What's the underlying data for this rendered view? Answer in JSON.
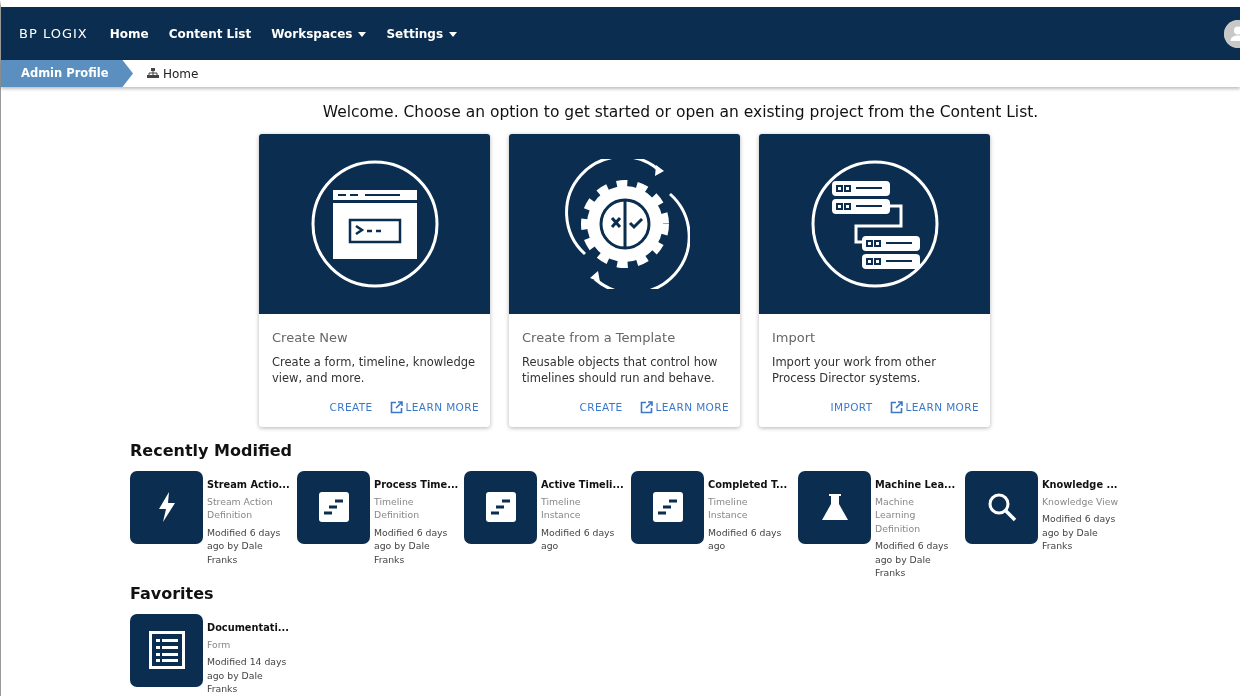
{
  "navbar": {
    "logo": "BP LOGIX",
    "links": [
      {
        "label": "Home",
        "dropdown": false
      },
      {
        "label": "Content List",
        "dropdown": false
      },
      {
        "label": "Workspaces",
        "dropdown": true
      },
      {
        "label": "Settings",
        "dropdown": true
      }
    ]
  },
  "breadcrumb": {
    "profile": "Admin Profile",
    "current": "Home"
  },
  "welcome": "Welcome. Choose an option to get started or open an existing project from the Content List.",
  "option_cards": [
    {
      "kind": "window",
      "title": "Create New",
      "text": "Create a form, timeline, knowledge view, and more.",
      "action": "CREATE",
      "learn_more": "LEARN MORE"
    },
    {
      "kind": "gear",
      "title": "Create from a Template",
      "text": "Reusable objects that control how timelines should run and behave.",
      "action": "CREATE",
      "learn_more": "LEARN MORE"
    },
    {
      "kind": "servers",
      "title": "Import",
      "text": "Import your work from other Process Director systems.",
      "action": "IMPORT",
      "learn_more": "LEARN MORE"
    }
  ],
  "recently_modified": {
    "title": "Recently Modified",
    "items": [
      {
        "kind": "bolt",
        "name": "Stream Actio...",
        "type": "Stream Action Definition",
        "modified": "Modified 6 days ago by Dale Franks"
      },
      {
        "kind": "timeline",
        "name": "Process Time...",
        "type": "Timeline Definition",
        "modified": "Modified 6 days ago by Dale Franks"
      },
      {
        "kind": "timeline",
        "name": "Active Timeli...",
        "type": "Timeline Instance",
        "modified": "Modified 6 days ago"
      },
      {
        "kind": "timeline",
        "name": "Completed T...",
        "type": "Timeline Instance",
        "modified": "Modified 6 days ago"
      },
      {
        "kind": "flask",
        "name": "Machine Lea...",
        "type": "Machine Learning Definition",
        "modified": "Modified 6 days ago by Dale Franks"
      },
      {
        "kind": "search",
        "name": "Knowledge ...",
        "type": "Knowledge View",
        "modified": "Modified 6 days ago by Dale Franks"
      }
    ]
  },
  "favorites": {
    "title": "Favorites",
    "items": [
      {
        "kind": "form",
        "name": "Documentati...",
        "type": "Form",
        "modified": "Modified 14 days ago by Dale Franks"
      }
    ]
  }
}
